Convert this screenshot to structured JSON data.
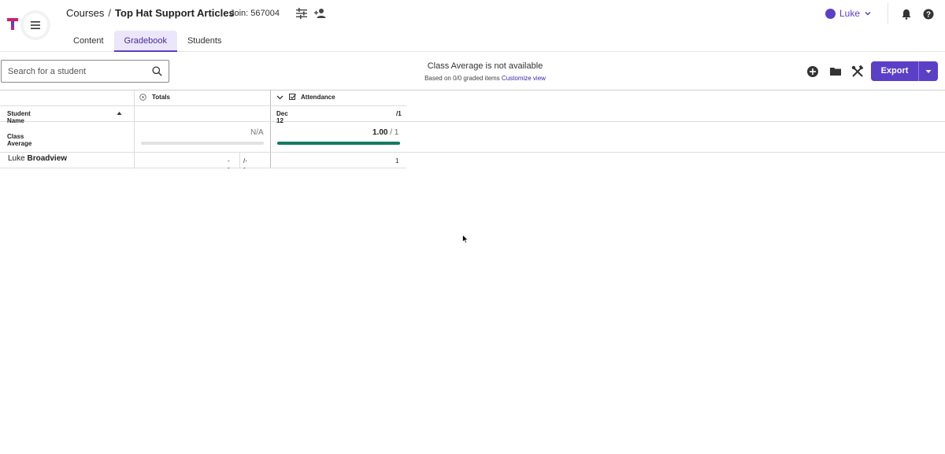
{
  "header": {
    "breadcrumb_root": "Courses",
    "breadcrumb_sep": "/",
    "course_title": "Top Hat Support Articles",
    "join_code": "Join: 567004",
    "user_name": "Luke",
    "tabs": [
      {
        "label": "Content"
      },
      {
        "label": "Gradebook"
      },
      {
        "label": "Students"
      }
    ],
    "active_tab": "Gradebook"
  },
  "toolbar": {
    "search_placeholder": "Search for a student",
    "class_average_title": "Class Average is not available",
    "class_average_sub": "Based on 0/0 graded items",
    "customize_link": "Customize view",
    "export_label": "Export"
  },
  "grid": {
    "groups": {
      "totals": "Totals",
      "attendance": "Attendance"
    },
    "columns": {
      "student_name": "Student Name",
      "attendance_date": "Dec 12",
      "attendance_max": "/1"
    },
    "class_average_row": {
      "label": "Class Average",
      "totals_value": "N/A",
      "attendance_value": "1.00",
      "attendance_max": "/ 1",
      "attendance_progress": 1.0
    },
    "students": [
      {
        "first": "Luke",
        "last": "Broadview",
        "total_value": "--",
        "total_max": "/--",
        "attendance": "1"
      }
    ]
  },
  "colors": {
    "accent": "#5b3fc7",
    "progress": "#137a63",
    "logo_pink": "#d11f6a"
  }
}
